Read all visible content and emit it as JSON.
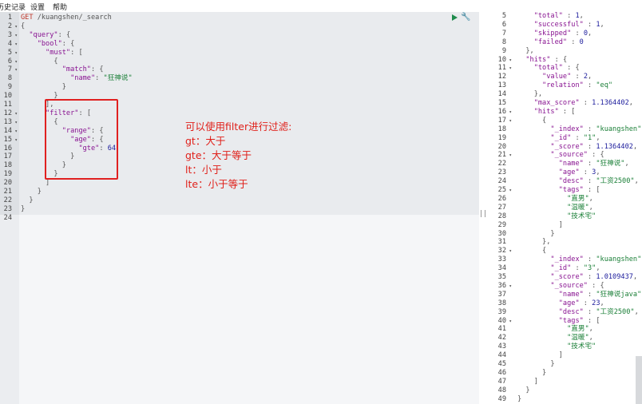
{
  "menu": {
    "items": [
      "历史记录",
      "设置",
      "帮助"
    ]
  },
  "request_editor": {
    "lines": [
      {
        "n": "1",
        "text": "GET /kuangshen/_search"
      },
      {
        "n": "2",
        "text": "{"
      },
      {
        "n": "3",
        "text": "  \"query\": {"
      },
      {
        "n": "4",
        "text": "    \"bool\": {"
      },
      {
        "n": "5",
        "text": "      \"must\": ["
      },
      {
        "n": "6",
        "text": "        {"
      },
      {
        "n": "7",
        "text": "          \"match\": {"
      },
      {
        "n": "8",
        "text": "            \"name\": \"狂神说\""
      },
      {
        "n": "9",
        "text": "          }"
      },
      {
        "n": "10",
        "text": "        }"
      },
      {
        "n": "11",
        "text": "      ],"
      },
      {
        "n": "12",
        "text": "      \"filter\": ["
      },
      {
        "n": "13",
        "text": "        {"
      },
      {
        "n": "14",
        "text": "          \"range\": {"
      },
      {
        "n": "15",
        "text": "            \"age\": {"
      },
      {
        "n": "16",
        "text": "              \"gte\": 64"
      },
      {
        "n": "17",
        "text": "            }"
      },
      {
        "n": "18",
        "text": "          }"
      },
      {
        "n": "19",
        "text": "        }"
      },
      {
        "n": "20",
        "text": "      ]"
      },
      {
        "n": "21",
        "text": "    }"
      },
      {
        "n": "22",
        "text": "  }"
      },
      {
        "n": "23",
        "text": "}"
      },
      {
        "n": "24",
        "text": ""
      }
    ],
    "fold_lines": [
      "2",
      "3",
      "4",
      "5",
      "6",
      "7",
      "12",
      "13",
      "14",
      "15"
    ]
  },
  "annotation": {
    "lines": [
      "可以使用filter进行过滤:",
      "gt：大于",
      "gte：大于等于",
      "lt：小于",
      "lte：小于等于"
    ],
    "color": "#e0201a"
  },
  "response_viewer": {
    "lines": [
      {
        "n": "5",
        "text": "    \"total\" : 1,"
      },
      {
        "n": "6",
        "text": "    \"successful\" : 1,"
      },
      {
        "n": "7",
        "text": "    \"skipped\" : 0,"
      },
      {
        "n": "8",
        "text": "    \"failed\" : 0"
      },
      {
        "n": "9",
        "text": "  },"
      },
      {
        "n": "10",
        "text": "  \"hits\" : {"
      },
      {
        "n": "11",
        "text": "    \"total\" : {"
      },
      {
        "n": "12",
        "text": "      \"value\" : 2,"
      },
      {
        "n": "13",
        "text": "      \"relation\" : \"eq\""
      },
      {
        "n": "14",
        "text": "    },"
      },
      {
        "n": "15",
        "text": "    \"max_score\" : 1.1364402,"
      },
      {
        "n": "16",
        "text": "    \"hits\" : ["
      },
      {
        "n": "17",
        "text": "      {"
      },
      {
        "n": "18",
        "text": "        \"_index\" : \"kuangshen\","
      },
      {
        "n": "19",
        "text": "        \"_id\" : \"1\","
      },
      {
        "n": "20",
        "text": "        \"_score\" : 1.1364402,"
      },
      {
        "n": "21",
        "text": "        \"_source\" : {"
      },
      {
        "n": "22",
        "text": "          \"name\" : \"狂神说\","
      },
      {
        "n": "23",
        "text": "          \"age\" : 3,"
      },
      {
        "n": "24",
        "text": "          \"desc\" : \"工资2500\","
      },
      {
        "n": "25",
        "text": "          \"tags\" : ["
      },
      {
        "n": "26",
        "text": "            \"直男\","
      },
      {
        "n": "27",
        "text": "            \"温暖\","
      },
      {
        "n": "28",
        "text": "            \"技术宅\""
      },
      {
        "n": "29",
        "text": "          ]"
      },
      {
        "n": "30",
        "text": "        }"
      },
      {
        "n": "31",
        "text": "      },"
      },
      {
        "n": "32",
        "text": "      {"
      },
      {
        "n": "33",
        "text": "        \"_index\" : \"kuangshen\","
      },
      {
        "n": "34",
        "text": "        \"_id\" : \"3\","
      },
      {
        "n": "35",
        "text": "        \"_score\" : 1.0109437,"
      },
      {
        "n": "36",
        "text": "        \"_source\" : {"
      },
      {
        "n": "37",
        "text": "          \"name\" : \"狂神说java\","
      },
      {
        "n": "38",
        "text": "          \"age\" : 23,"
      },
      {
        "n": "39",
        "text": "          \"desc\" : \"工资2500\","
      },
      {
        "n": "40",
        "text": "          \"tags\" : ["
      },
      {
        "n": "41",
        "text": "            \"直男\","
      },
      {
        "n": "42",
        "text": "            \"温暖\","
      },
      {
        "n": "43",
        "text": "            \"技术宅\""
      },
      {
        "n": "44",
        "text": "          ]"
      },
      {
        "n": "45",
        "text": "        }"
      },
      {
        "n": "46",
        "text": "      }"
      },
      {
        "n": "47",
        "text": "    ]"
      },
      {
        "n": "48",
        "text": "  }"
      },
      {
        "n": "49",
        "text": "}"
      }
    ],
    "fold_lines": [
      "10",
      "11",
      "16",
      "17",
      "21",
      "25",
      "32",
      "36",
      "40"
    ]
  },
  "icons": {
    "run": "play-icon",
    "settings": "wrench-icon"
  }
}
